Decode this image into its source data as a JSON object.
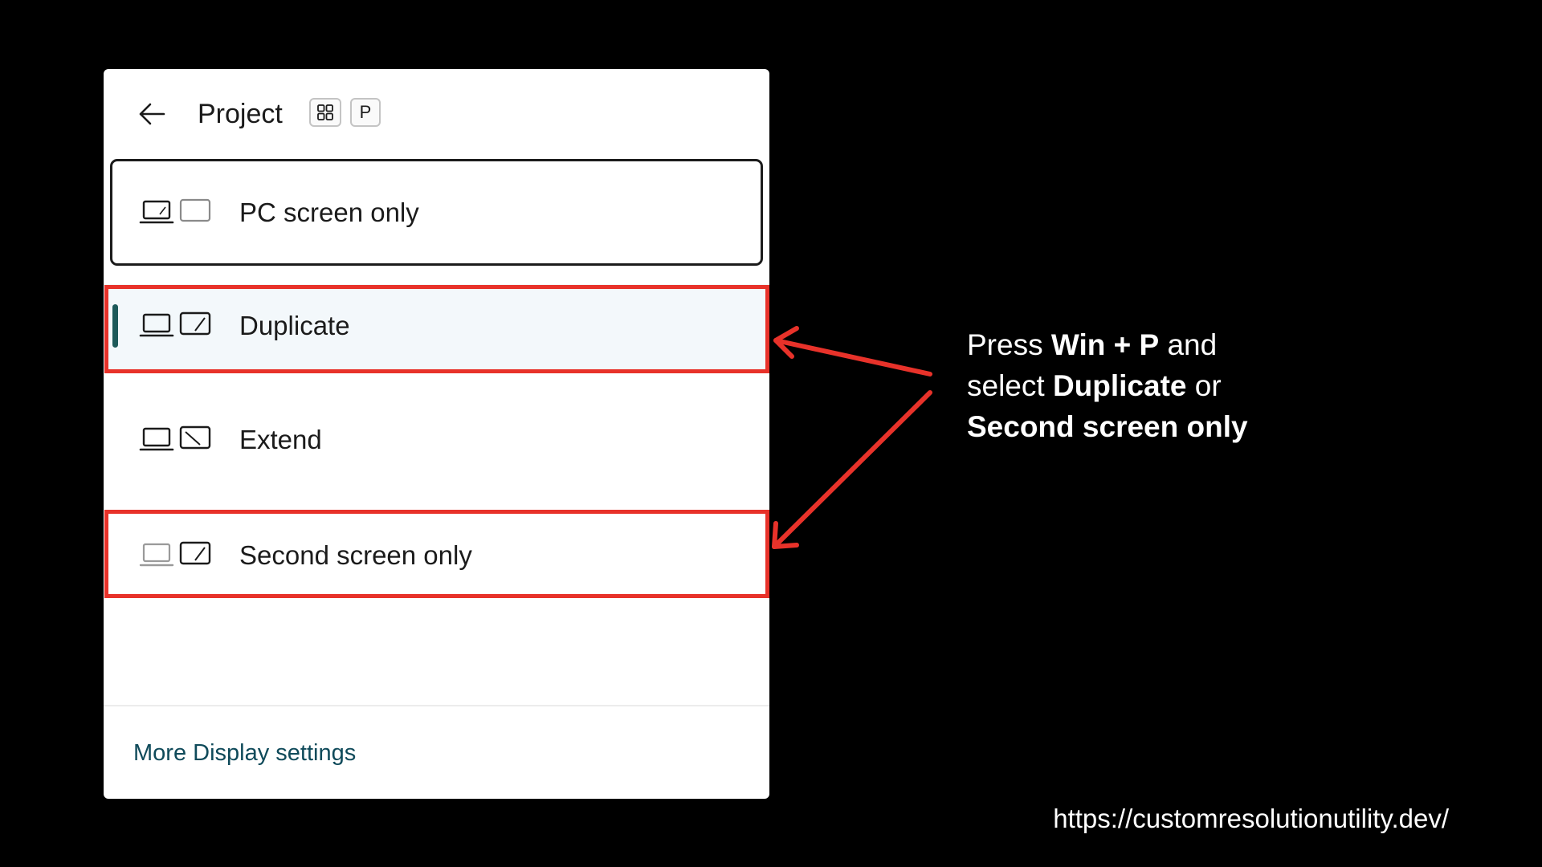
{
  "panel": {
    "title": "Project",
    "shortcut_keys": [
      "⊞",
      "P"
    ],
    "options": [
      {
        "label": "PC screen only",
        "icon": "pc-screen-only-icon",
        "focused": true
      },
      {
        "label": "Duplicate",
        "icon": "duplicate-icon",
        "selected": true
      },
      {
        "label": "Extend",
        "icon": "extend-icon"
      },
      {
        "label": "Second screen only",
        "icon": "second-screen-only-icon"
      }
    ],
    "more_settings_label": "More Display settings"
  },
  "callout": {
    "line1_prefix": "Press ",
    "line1_bold": "Win + P",
    "line1_suffix": " and",
    "line2_prefix": "select ",
    "line2_bold": "Duplicate",
    "line2_suffix": " or",
    "line3_bold": "Second screen only"
  },
  "footer_url": "https://customresolutionutility.dev/",
  "colors": {
    "background": "#000000",
    "panel": "#ffffff",
    "highlight": "#e8322a",
    "selection_bar": "#1d5a5a",
    "link": "#0f4a5a"
  }
}
